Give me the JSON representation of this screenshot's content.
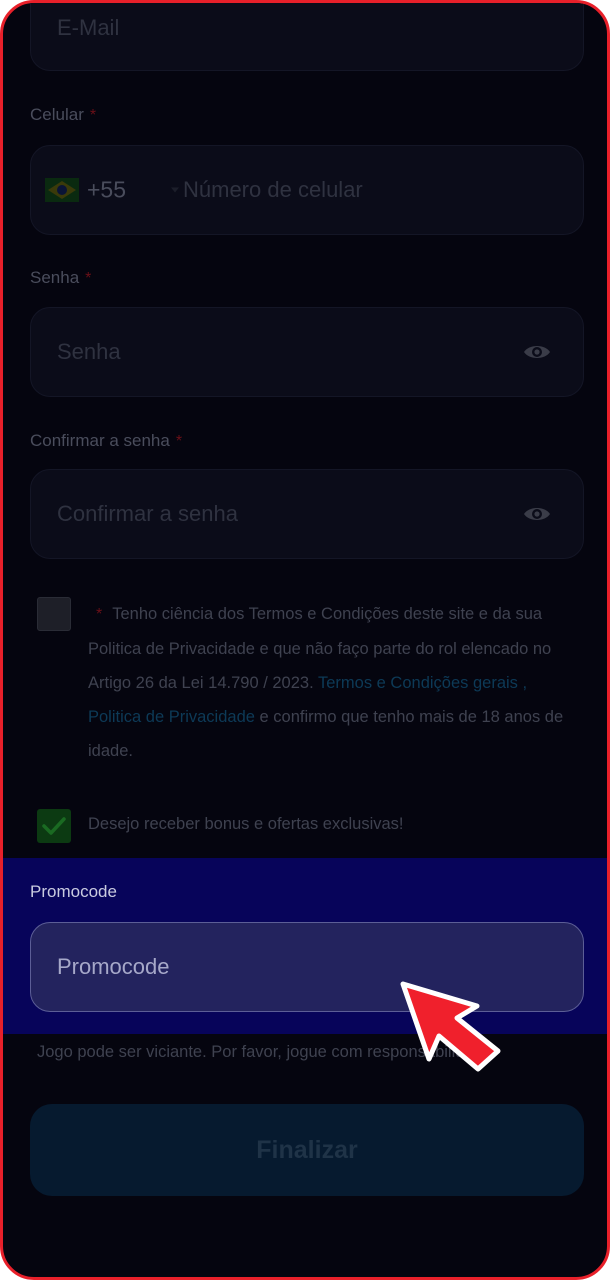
{
  "email": {
    "placeholder": "E-Mail"
  },
  "phone": {
    "label": "Celular",
    "required_mark": "*",
    "dial_code": "+55",
    "placeholder": "Número de celular",
    "flag_icon": "brazil-flag-icon"
  },
  "password": {
    "label": "Senha",
    "required_mark": "*",
    "placeholder": "Senha",
    "toggle_icon": "eye-icon"
  },
  "confirm_password": {
    "label": "Confirmar a senha",
    "required_mark": "*",
    "placeholder": "Confirmar a senha",
    "toggle_icon": "eye-icon"
  },
  "terms": {
    "checked": false,
    "required_mark": "*",
    "text_before": "Tenho ciência dos Termos e Condições deste site e da sua Politica de Privacidade e que não faço parte do rol elencado no Artigo 26 da Lei 14.790 / 2023.",
    "link_terms": "Termos e Condições gerais",
    "separator": ",",
    "link_privacy": "Politica de Privacidade",
    "text_after": "e confirmo que tenho mais de 18 anos de idade."
  },
  "bonus": {
    "checked": true,
    "label": "Desejo receber bonus e ofertas exclusivas!"
  },
  "promocode": {
    "label": "Promocode",
    "placeholder": "Promocode"
  },
  "warning": "Jogo pode ser viciante. Por favor, jogue com responsabilidade.",
  "submit_label": "Finalizar",
  "colors": {
    "frame_border": "#e8202a",
    "highlight": "#07045a",
    "cursor": "#f0202c"
  }
}
